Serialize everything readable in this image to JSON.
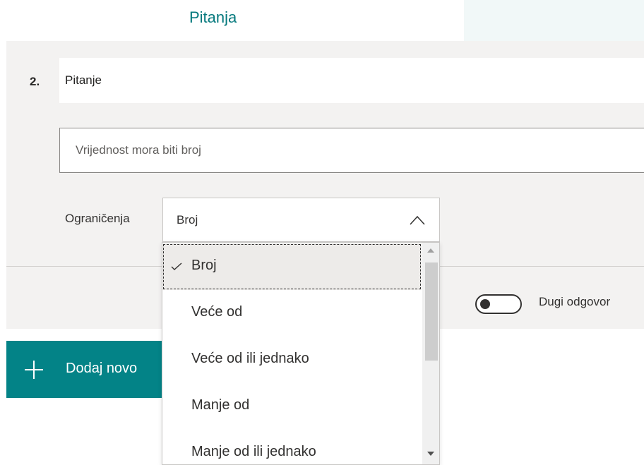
{
  "tabs": {
    "questions_label": "Pitanja"
  },
  "question": {
    "number": "2.",
    "title": "Pitanje",
    "hint_placeholder": "Vrijednost mora biti broj",
    "restrictions_label": "Ograničenja",
    "restriction_selected": "Broj",
    "long_answer_label": "Dugi odgovor",
    "long_answer_on": false
  },
  "add_new": {
    "label": "Dodaj novo"
  },
  "dropdown": {
    "options": [
      {
        "label": "Broj",
        "selected": true
      },
      {
        "label": "Veće od",
        "selected": false
      },
      {
        "label": "Veće od ili jednako",
        "selected": false
      },
      {
        "label": "Manje od",
        "selected": false
      },
      {
        "label": "Manje od ili jednako",
        "selected": false
      }
    ]
  },
  "colors": {
    "accent": "#038387",
    "tab_text": "#03787c",
    "card_bg": "#f3f2f1"
  },
  "icons": [
    "chevron-up-icon",
    "checkmark-icon",
    "plus-icon",
    "toggle-switch"
  ]
}
